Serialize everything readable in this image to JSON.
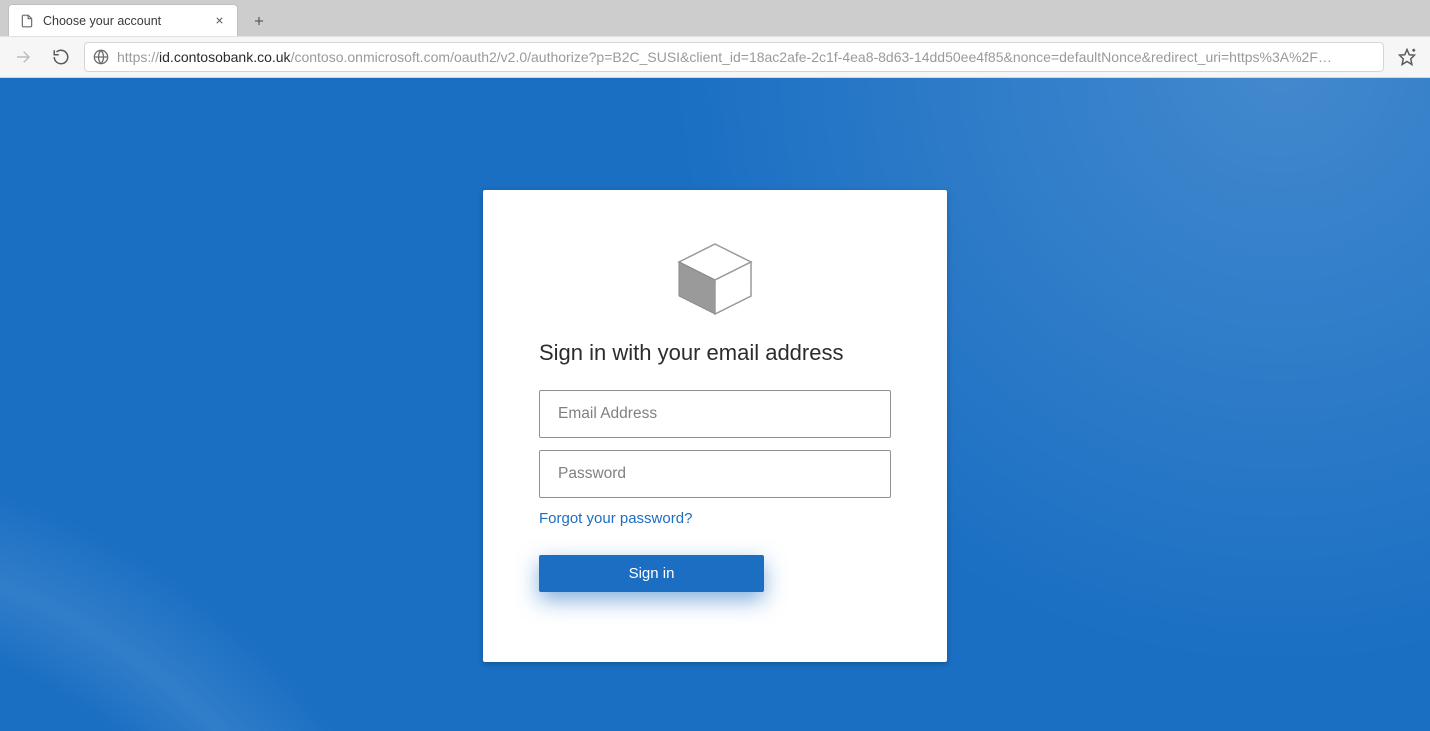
{
  "browser": {
    "tab_title": "Choose your account",
    "url_parts": {
      "prefix": "https://",
      "host": "id.contosobank.co.uk",
      "rest": "/contoso.onmicrosoft.com/oauth2/v2.0/authorize?p=B2C_SUSI&client_id=18ac2afe-2c1f-4ea8-8d63-14dd50ee4f85&nonce=defaultNonce&redirect_uri=https%3A%2F…"
    }
  },
  "signin": {
    "heading": "Sign in with your email address",
    "email_placeholder": "Email Address",
    "password_placeholder": "Password",
    "forgot_label": "Forgot your password?",
    "button_label": "Sign in"
  }
}
